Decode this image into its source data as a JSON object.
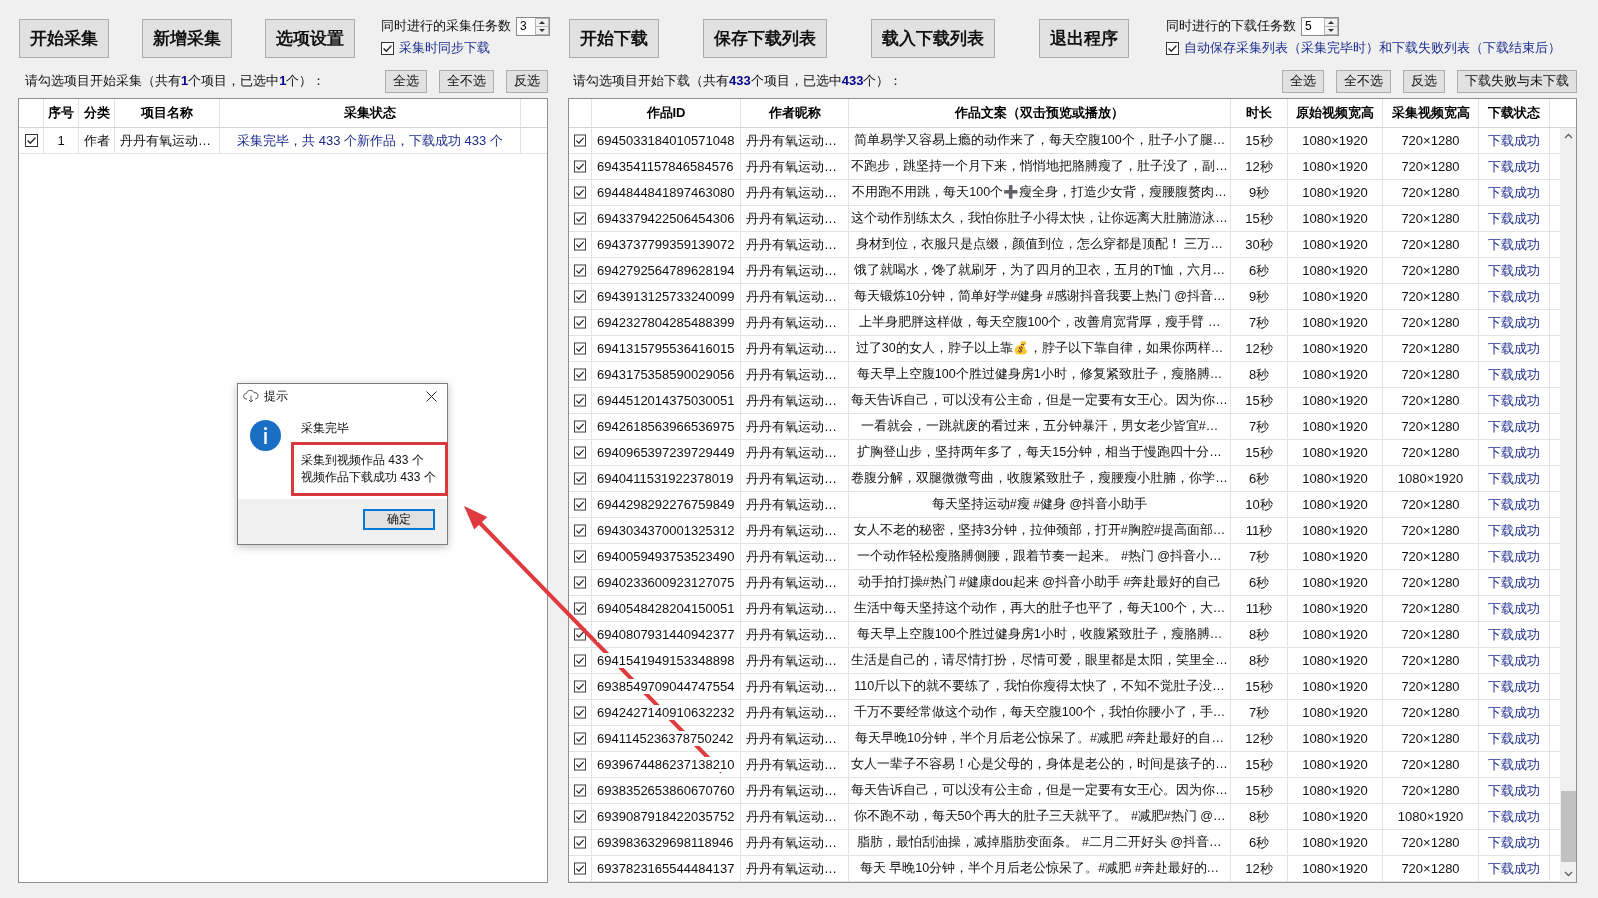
{
  "collect_panel": {
    "toolbar_buttons": [
      "开始采集",
      "新增采集",
      "选项设置"
    ],
    "concurrency": {
      "label": "同时进行的采集任务数",
      "value": "3"
    },
    "sync_download": {
      "label": "采集时同步下载",
      "checked": true
    },
    "summary": "请勾选项目开始采集（共有**1**个项目，已选中**1**个）：",
    "selection_buttons": [
      "全选",
      "全不选",
      "反选"
    ],
    "table": {
      "columns": [
        "序号",
        "分类",
        "项目名称",
        "采集状态"
      ],
      "rows": [
        {
          "checked": true,
          "number": "1",
          "category": "作者",
          "name": "丹丹有氧运动…",
          "status": "采集完毕，共 433 个新作品，下载成功 433 个"
        }
      ]
    }
  },
  "download_panel": {
    "toolbar_buttons": [
      "开始下载",
      "保存下载列表",
      "载入下载列表",
      "退出程序"
    ],
    "concurrency": {
      "label": "同时进行的下载任务数",
      "value": "5"
    },
    "auto_save": {
      "label": "自动保存采集列表（采集完毕时）和下载失败列表（下载结束后）",
      "checked": true
    },
    "summary": "请勾选项目开始下载（共有**433**个项目，已选中**433**个）：",
    "selection_buttons": [
      "全选",
      "全不选",
      "反选",
      "下载失败与未下载"
    ],
    "table": {
      "columns": [
        "作品ID",
        "作者昵称",
        "作品文案（双击预览或播放）",
        "时长",
        "原始视频宽高",
        "采集视频宽高",
        "下载状态"
      ],
      "rows": [
        {
          "checked": true,
          "id": "6945033184010571048",
          "author": "丹丹有氧运动…",
          "caption": "简单易学又容易上瘾的动作来了，每天空腹100个，肚子小了腿…",
          "duration": "15秒",
          "original_size": "1080×1920",
          "collected_size": "720×1280",
          "status": "下载成功"
        },
        {
          "checked": true,
          "id": "6943541157846584576",
          "author": "丹丹有氧运动…",
          "caption": "不跑步，跳坚持一个月下来，悄悄地把胳膊瘦了，肚子没了，副…",
          "duration": "12秒",
          "original_size": "1080×1920",
          "collected_size": "720×1280",
          "status": "下载成功"
        },
        {
          "checked": true,
          "id": "6944844841897463080",
          "author": "丹丹有氧运动…",
          "caption": "不用跑不用跳，每天100个➕瘦全身，打造少女背，瘦腰腹赘肉…",
          "duration": "9秒",
          "original_size": "1080×1920",
          "collected_size": "720×1280",
          "status": "下载成功"
        },
        {
          "checked": true,
          "id": "6943379422506454306",
          "author": "丹丹有氧运动…",
          "caption": "这个动作别练太久，我怕你肚子小得太快，让你远离大肚腩游泳…",
          "duration": "15秒",
          "original_size": "1080×1920",
          "collected_size": "720×1280",
          "status": "下载成功"
        },
        {
          "checked": true,
          "id": "6943737799359139072",
          "author": "丹丹有氧运动…",
          "caption": "身材到位，衣服只是点缀，颜值到位，怎么穿都是顶配！ 三万…",
          "duration": "30秒",
          "original_size": "1080×1920",
          "collected_size": "720×1280",
          "status": "下载成功"
        },
        {
          "checked": true,
          "id": "6942792564789628194",
          "author": "丹丹有氧运动…",
          "caption": "饿了就喝水，馋了就刷牙，为了四月的卫衣，五月的T恤，六月…",
          "duration": "6秒",
          "original_size": "1080×1920",
          "collected_size": "720×1280",
          "status": "下载成功"
        },
        {
          "checked": true,
          "id": "6943913125733240099",
          "author": "丹丹有氧运动…",
          "caption": "每天锻炼10分钟，简单好学#健身 #感谢抖音我要上热门 @抖音…",
          "duration": "9秒",
          "original_size": "1080×1920",
          "collected_size": "720×1280",
          "status": "下载成功"
        },
        {
          "checked": true,
          "id": "6942327804285488399",
          "author": "丹丹有氧运动…",
          "caption": "上半身肥胖这样做，每天空腹100个，改善肩宽背厚，瘦手臂 …",
          "duration": "7秒",
          "original_size": "1080×1920",
          "collected_size": "720×1280",
          "status": "下载成功"
        },
        {
          "checked": true,
          "id": "6941315795536416015",
          "author": "丹丹有氧运动…",
          "caption": "过了30的女人，脖子以上靠💰，脖子以下靠自律，如果你两样…",
          "duration": "12秒",
          "original_size": "1080×1920",
          "collected_size": "720×1280",
          "status": "下载成功"
        },
        {
          "checked": true,
          "id": "6943175358590029056",
          "author": "丹丹有氧运动…",
          "caption": "每天早上空腹100个胜过健身房1小时，修复紧致肚子，瘦胳膊…",
          "duration": "8秒",
          "original_size": "1080×1920",
          "collected_size": "720×1280",
          "status": "下载成功"
        },
        {
          "checked": true,
          "id": "6944512014375030051",
          "author": "丹丹有氧运动…",
          "caption": "每天告诉自己，可以没有公主命，但是一定要有女王心。因为你…",
          "duration": "15秒",
          "original_size": "1080×1920",
          "collected_size": "720×1280",
          "status": "下载成功"
        },
        {
          "checked": true,
          "id": "6942618563966536975",
          "author": "丹丹有氧运动…",
          "caption": "一看就会，一跳就废的看过来，五分钟暴汗，男女老少皆宜#…",
          "duration": "7秒",
          "original_size": "1080×1920",
          "collected_size": "720×1280",
          "status": "下载成功"
        },
        {
          "checked": true,
          "id": "6940965397239729449",
          "author": "丹丹有氧运动…",
          "caption": "扩胸登山步，坚持两年多了，每天15分钟，相当于慢跑四十分…",
          "duration": "15秒",
          "original_size": "1080×1920",
          "collected_size": "720×1280",
          "status": "下载成功"
        },
        {
          "checked": true,
          "id": "6940411531922378019",
          "author": "丹丹有氧运动…",
          "caption": "卷腹分解，双腿微微弯曲，收腹紧致肚子，瘦腰瘦小肚腩，你学…",
          "duration": "6秒",
          "original_size": "1080×1920",
          "collected_size": "1080×1920",
          "status": "下载成功"
        },
        {
          "checked": true,
          "id": "6944298292276759849",
          "author": "丹丹有氧运动…",
          "caption": "每天坚持运动#瘦 #健身 @抖音小助手",
          "duration": "10秒",
          "original_size": "1080×1920",
          "collected_size": "720×1280",
          "status": "下载成功"
        },
        {
          "checked": true,
          "id": "6943034370001325312",
          "author": "丹丹有氧运动…",
          "caption": "女人不老的秘密，坚持3分钟，拉伸颈部，打开#胸腔#提高面部…",
          "duration": "11秒",
          "original_size": "1080×1920",
          "collected_size": "720×1280",
          "status": "下载成功"
        },
        {
          "checked": true,
          "id": "6940059493753523490",
          "author": "丹丹有氧运动…",
          "caption": "一个动作轻松瘦胳膊侧腰，跟着节奏一起来。 #热门 @抖音小…",
          "duration": "7秒",
          "original_size": "1080×1920",
          "collected_size": "720×1280",
          "status": "下载成功"
        },
        {
          "checked": true,
          "id": "6940233600923127075",
          "author": "丹丹有氧运动…",
          "caption": "动手拍打操#热门 #健康dou起来 @抖音小助手 #奔赴最好的自己",
          "duration": "6秒",
          "original_size": "1080×1920",
          "collected_size": "720×1280",
          "status": "下载成功"
        },
        {
          "checked": true,
          "id": "6940548428204150051",
          "author": "丹丹有氧运动…",
          "caption": "生活中每天坚持这个动作，再大的肚子也平了，每天100个，大…",
          "duration": "11秒",
          "original_size": "1080×1920",
          "collected_size": "720×1280",
          "status": "下载成功"
        },
        {
          "checked": true,
          "id": "6940807931440942377",
          "author": "丹丹有氧运动…",
          "caption": "每天早上空腹100个胜过健身房1小时，收腹紧致肚子，瘦胳膊…",
          "duration": "8秒",
          "original_size": "1080×1920",
          "collected_size": "720×1280",
          "status": "下载成功"
        },
        {
          "checked": true,
          "id": "6941541949153348898",
          "author": "丹丹有氧运动…",
          "caption": "生活是自己的，请尽情打扮，尽情可爱，眼里都是太阳，笑里全…",
          "duration": "8秒",
          "original_size": "1080×1920",
          "collected_size": "720×1280",
          "status": "下载成功"
        },
        {
          "checked": true,
          "id": "6938549709044747554",
          "author": "丹丹有氧运动…",
          "caption": "110斤以下的就不要练了，我怕你瘦得太快了，不知不觉肚子没…",
          "duration": "15秒",
          "original_size": "1080×1920",
          "collected_size": "720×1280",
          "status": "下载成功"
        },
        {
          "checked": true,
          "id": "6942427140910632232",
          "author": "丹丹有氧运动…",
          "caption": "千万不要经常做这个动作，每天空腹100个，我怕你腰小了，手…",
          "duration": "7秒",
          "original_size": "1080×1920",
          "collected_size": "720×1280",
          "status": "下载成功"
        },
        {
          "checked": true,
          "id": "6941145236378750242",
          "author": "丹丹有氧运动…",
          "caption": "每天早晚10分钟，半个月后老公惊呆了。#减肥 #奔赴最好的自…",
          "duration": "12秒",
          "original_size": "1080×1920",
          "collected_size": "720×1280",
          "status": "下载成功"
        },
        {
          "checked": true,
          "id": "6939674486237138210",
          "author": "丹丹有氧运动…",
          "caption": "女人一辈子不容易！心是父母的，身体是老公的，时间是孩子的…",
          "duration": "15秒",
          "original_size": "1080×1920",
          "collected_size": "720×1280",
          "status": "下载成功"
        },
        {
          "checked": true,
          "id": "6938352653860670760",
          "author": "丹丹有氧运动…",
          "caption": "每天告诉自己，可以没有公主命，但是一定要有女王心。因为你…",
          "duration": "15秒",
          "original_size": "1080×1920",
          "collected_size": "720×1280",
          "status": "下载成功"
        },
        {
          "checked": true,
          "id": "6939087918422035752",
          "author": "丹丹有氧运动…",
          "caption": "你不跑不动，每天50个再大的肚子三天就平了。 #减肥#热门 @…",
          "duration": "8秒",
          "original_size": "1080×1920",
          "collected_size": "1080×1920",
          "status": "下载成功"
        },
        {
          "checked": true,
          "id": "6939836329698118946",
          "author": "丹丹有氧运动…",
          "caption": "脂肪，最怕刮油操，减掉脂肪变面条。 #二月二开好头 @抖音…",
          "duration": "6秒",
          "original_size": "1080×1920",
          "collected_size": "720×1280",
          "status": "下载成功"
        },
        {
          "checked": true,
          "id": "6937823165544484137",
          "author": "丹丹有氧运动…",
          "caption": "每天 早晚10分钟，半个月后老公惊呆了。#减肥 #奔赴最好的…",
          "duration": "12秒",
          "original_size": "1080×1920",
          "collected_size": "720×1280",
          "status": "下载成功"
        }
      ]
    }
  },
  "dialog": {
    "title": "提示",
    "heading": "采集完毕",
    "message_lines": [
      "采集到视频作品 433 个",
      "视频作品下载成功 433 个"
    ],
    "button": "确定"
  }
}
